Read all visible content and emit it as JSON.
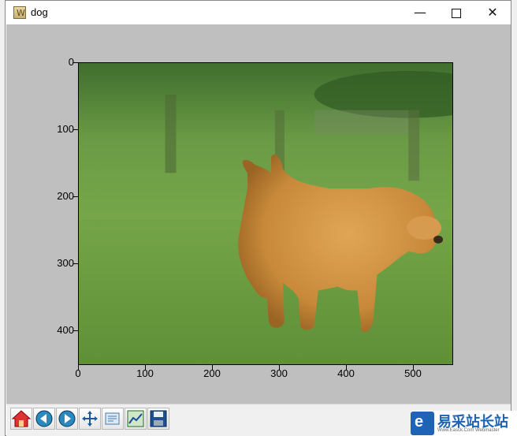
{
  "window": {
    "title": "dog",
    "app_icon_glyph": "W",
    "minimize_glyph": "—",
    "close_glyph": "✕"
  },
  "plot": {
    "y_ticks": [
      "0",
      "100",
      "200",
      "300",
      "400"
    ],
    "x_ticks": [
      "0",
      "100",
      "200",
      "300",
      "400",
      "500"
    ],
    "image_description_colors": {
      "grass": "#5f9a3a",
      "dog": "#c98a3c",
      "background_blur": "#4f7a3a"
    }
  },
  "toolbar": {
    "buttons": [
      {
        "name": "home-icon"
      },
      {
        "name": "back-icon"
      },
      {
        "name": "forward-icon"
      },
      {
        "name": "pan-icon"
      },
      {
        "name": "zoom-icon"
      },
      {
        "name": "configure-subplots-icon"
      },
      {
        "name": "save-icon"
      }
    ]
  },
  "watermark": {
    "text": "易采站长站",
    "sub": "Www.Easck.Com Webmaster",
    "logo_glyph": "e"
  }
}
